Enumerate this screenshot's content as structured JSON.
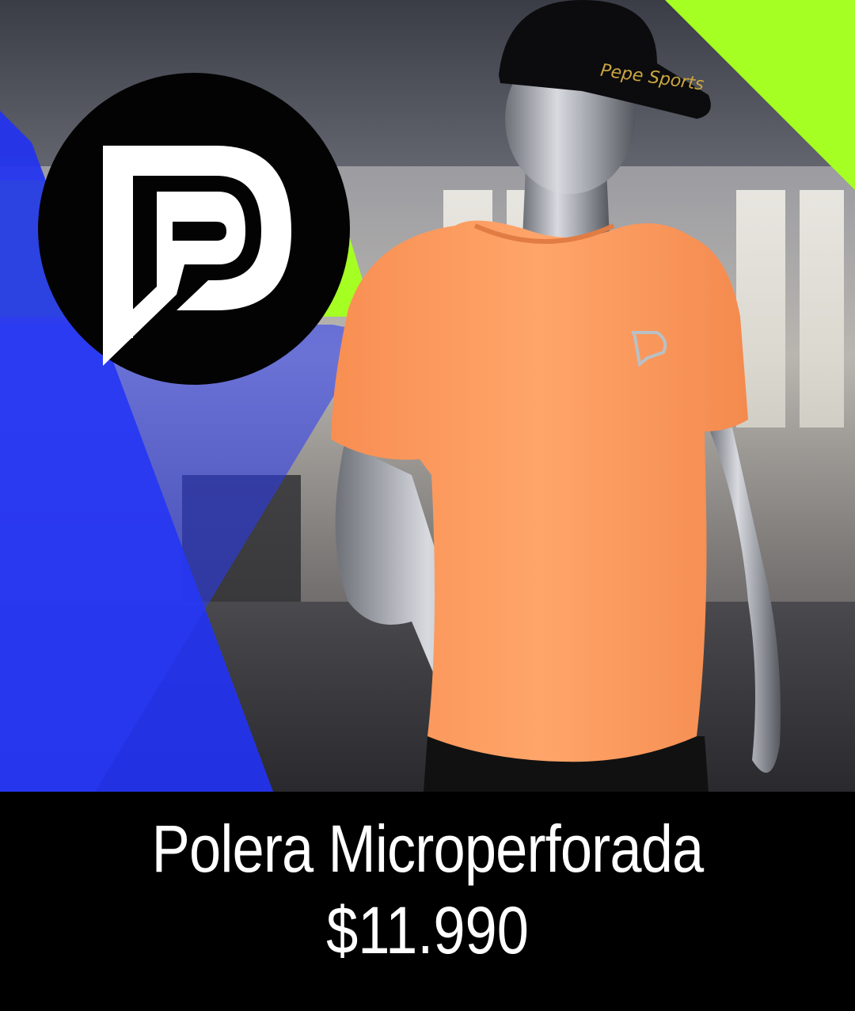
{
  "product": {
    "title": "Polera Microperforada",
    "price": "$11.990"
  },
  "brand": {
    "logo_icon": "pepe-sports-p-logo-icon",
    "cap_text": "Pepe Sports"
  },
  "colors": {
    "accent_lime": "#a6ff22",
    "accent_blue": "#2030f0",
    "shirt_orange": "#ffa062",
    "caption_bg": "#000000",
    "caption_text": "#ffffff"
  }
}
